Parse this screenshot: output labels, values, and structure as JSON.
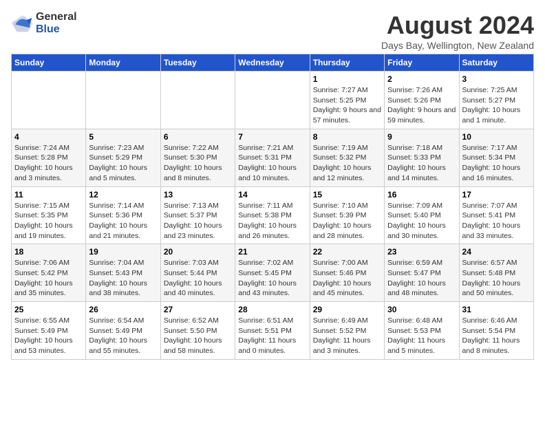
{
  "logo": {
    "general": "General",
    "blue": "Blue"
  },
  "header": {
    "title": "August 2024",
    "subtitle": "Days Bay, Wellington, New Zealand"
  },
  "weekdays": [
    "Sunday",
    "Monday",
    "Tuesday",
    "Wednesday",
    "Thursday",
    "Friday",
    "Saturday"
  ],
  "weeks": [
    [
      {
        "day": "",
        "info": ""
      },
      {
        "day": "",
        "info": ""
      },
      {
        "day": "",
        "info": ""
      },
      {
        "day": "",
        "info": ""
      },
      {
        "day": "1",
        "info": "Sunrise: 7:27 AM\nSunset: 5:25 PM\nDaylight: 9 hours and 57 minutes."
      },
      {
        "day": "2",
        "info": "Sunrise: 7:26 AM\nSunset: 5:26 PM\nDaylight: 9 hours and 59 minutes."
      },
      {
        "day": "3",
        "info": "Sunrise: 7:25 AM\nSunset: 5:27 PM\nDaylight: 10 hours and 1 minute."
      }
    ],
    [
      {
        "day": "4",
        "info": "Sunrise: 7:24 AM\nSunset: 5:28 PM\nDaylight: 10 hours and 3 minutes."
      },
      {
        "day": "5",
        "info": "Sunrise: 7:23 AM\nSunset: 5:29 PM\nDaylight: 10 hours and 5 minutes."
      },
      {
        "day": "6",
        "info": "Sunrise: 7:22 AM\nSunset: 5:30 PM\nDaylight: 10 hours and 8 minutes."
      },
      {
        "day": "7",
        "info": "Sunrise: 7:21 AM\nSunset: 5:31 PM\nDaylight: 10 hours and 10 minutes."
      },
      {
        "day": "8",
        "info": "Sunrise: 7:19 AM\nSunset: 5:32 PM\nDaylight: 10 hours and 12 minutes."
      },
      {
        "day": "9",
        "info": "Sunrise: 7:18 AM\nSunset: 5:33 PM\nDaylight: 10 hours and 14 minutes."
      },
      {
        "day": "10",
        "info": "Sunrise: 7:17 AM\nSunset: 5:34 PM\nDaylight: 10 hours and 16 minutes."
      }
    ],
    [
      {
        "day": "11",
        "info": "Sunrise: 7:15 AM\nSunset: 5:35 PM\nDaylight: 10 hours and 19 minutes."
      },
      {
        "day": "12",
        "info": "Sunrise: 7:14 AM\nSunset: 5:36 PM\nDaylight: 10 hours and 21 minutes."
      },
      {
        "day": "13",
        "info": "Sunrise: 7:13 AM\nSunset: 5:37 PM\nDaylight: 10 hours and 23 minutes."
      },
      {
        "day": "14",
        "info": "Sunrise: 7:11 AM\nSunset: 5:38 PM\nDaylight: 10 hours and 26 minutes."
      },
      {
        "day": "15",
        "info": "Sunrise: 7:10 AM\nSunset: 5:39 PM\nDaylight: 10 hours and 28 minutes."
      },
      {
        "day": "16",
        "info": "Sunrise: 7:09 AM\nSunset: 5:40 PM\nDaylight: 10 hours and 30 minutes."
      },
      {
        "day": "17",
        "info": "Sunrise: 7:07 AM\nSunset: 5:41 PM\nDaylight: 10 hours and 33 minutes."
      }
    ],
    [
      {
        "day": "18",
        "info": "Sunrise: 7:06 AM\nSunset: 5:42 PM\nDaylight: 10 hours and 35 minutes."
      },
      {
        "day": "19",
        "info": "Sunrise: 7:04 AM\nSunset: 5:43 PM\nDaylight: 10 hours and 38 minutes."
      },
      {
        "day": "20",
        "info": "Sunrise: 7:03 AM\nSunset: 5:44 PM\nDaylight: 10 hours and 40 minutes."
      },
      {
        "day": "21",
        "info": "Sunrise: 7:02 AM\nSunset: 5:45 PM\nDaylight: 10 hours and 43 minutes."
      },
      {
        "day": "22",
        "info": "Sunrise: 7:00 AM\nSunset: 5:46 PM\nDaylight: 10 hours and 45 minutes."
      },
      {
        "day": "23",
        "info": "Sunrise: 6:59 AM\nSunset: 5:47 PM\nDaylight: 10 hours and 48 minutes."
      },
      {
        "day": "24",
        "info": "Sunrise: 6:57 AM\nSunset: 5:48 PM\nDaylight: 10 hours and 50 minutes."
      }
    ],
    [
      {
        "day": "25",
        "info": "Sunrise: 6:55 AM\nSunset: 5:49 PM\nDaylight: 10 hours and 53 minutes."
      },
      {
        "day": "26",
        "info": "Sunrise: 6:54 AM\nSunset: 5:49 PM\nDaylight: 10 hours and 55 minutes."
      },
      {
        "day": "27",
        "info": "Sunrise: 6:52 AM\nSunset: 5:50 PM\nDaylight: 10 hours and 58 minutes."
      },
      {
        "day": "28",
        "info": "Sunrise: 6:51 AM\nSunset: 5:51 PM\nDaylight: 11 hours and 0 minutes."
      },
      {
        "day": "29",
        "info": "Sunrise: 6:49 AM\nSunset: 5:52 PM\nDaylight: 11 hours and 3 minutes."
      },
      {
        "day": "30",
        "info": "Sunrise: 6:48 AM\nSunset: 5:53 PM\nDaylight: 11 hours and 5 minutes."
      },
      {
        "day": "31",
        "info": "Sunrise: 6:46 AM\nSunset: 5:54 PM\nDaylight: 11 hours and 8 minutes."
      }
    ]
  ]
}
